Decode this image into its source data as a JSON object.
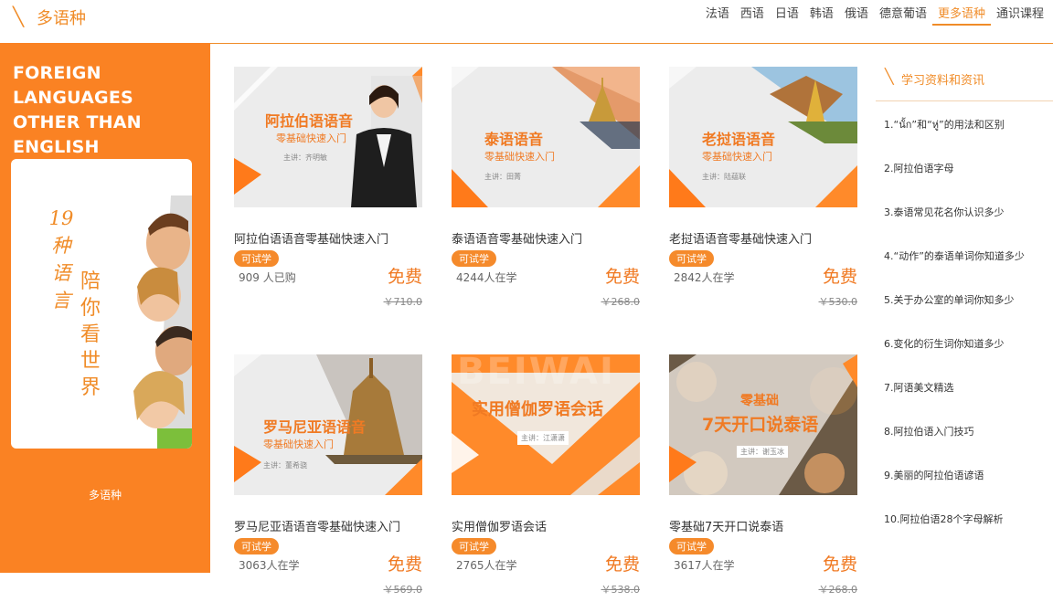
{
  "header": {
    "title": "多语种",
    "nav": [
      "法语",
      "西语",
      "日语",
      "韩语",
      "俄语",
      "德意葡语",
      "更多语种",
      "通识课程"
    ],
    "active_index": 6
  },
  "sidebar": {
    "title_line1": "FOREIGN LANGUAGES",
    "title_line2": "OTHER THAN ENGLISH",
    "num": "19",
    "lang_chars": [
      "种",
      "语",
      "言"
    ],
    "slogan_chars": [
      "陪",
      "你",
      "看",
      "世",
      "界"
    ],
    "footer_label": "多语种"
  },
  "courses": [
    {
      "thumb_title": "阿拉伯语语音",
      "thumb_sub": "零基础快速入门",
      "thumb_lecturer": "主讲：齐明敏",
      "name": "阿拉伯语语音零基础快速入门",
      "badge": "可试学",
      "count": "909 人已购",
      "price": "免费",
      "original": "￥710.0"
    },
    {
      "thumb_title": "泰语语音",
      "thumb_sub": "零基础快速入门",
      "thumb_lecturer": "主讲：田菁",
      "name": "泰语语音零基础快速入门",
      "badge": "可试学",
      "count": "4244人在学",
      "price": "免费",
      "original": "￥268.0"
    },
    {
      "thumb_title": "老挝语语音",
      "thumb_sub": "零基础快速入门",
      "thumb_lecturer": "主讲：陆蕴联",
      "name": "老挝语语音零基础快速入门",
      "badge": "可试学",
      "count": "2842人在学",
      "price": "免费",
      "original": "￥530.0"
    },
    {
      "thumb_title": "罗马尼亚语语音",
      "thumb_sub": "零基础快速入门",
      "thumb_lecturer": "主讲：董希骁",
      "name": "罗马尼亚语语音零基础快速入门",
      "badge": "可试学",
      "count": "3063人在学",
      "price": "免费",
      "original": "￥569.0"
    },
    {
      "thumb_title": "实用僧伽罗语会话",
      "thumb_sub": "BEIWAI",
      "thumb_lecturer": "主讲：江潇潇",
      "name": "实用僧伽罗语会话",
      "badge": "可试学",
      "count": "2765人在学",
      "price": "免费",
      "original": "￥538.0"
    },
    {
      "thumb_title": "7天开口说泰语",
      "thumb_sub": "零基础",
      "thumb_lecturer": "主讲：谢玉冰",
      "name": "零基础7天开口说泰语",
      "badge": "可试学",
      "count": "3617人在学",
      "price": "免费",
      "original": "￥268.0"
    }
  ],
  "resources": {
    "title": "学习资料和资讯",
    "items": [
      "1.“นั้ก”和“หู่”的用法和区别",
      "2.阿拉伯语字母",
      "3.泰语常见花名你认识多少",
      "4.“动作”的泰语单词你知道多少",
      "5.关于办公室的单词你知多少",
      "6.变化的衍生词你知道多少",
      "7.阿语美文精选",
      "8.阿拉伯语入门技巧",
      "9.美丽的阿拉伯语谚语",
      "10.阿拉伯语28个字母解析"
    ]
  },
  "colors": {
    "accent": "#f08c28",
    "sidebar_bg": "#fa8223"
  }
}
